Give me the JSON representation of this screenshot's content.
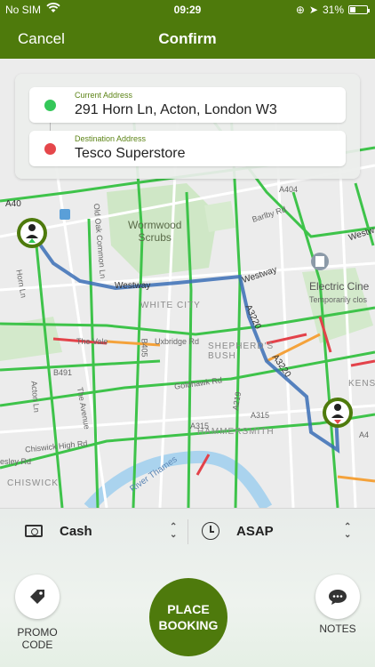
{
  "status_bar": {
    "carrier": "No SIM",
    "time": "09:29",
    "battery": "31%",
    "battery_level": 0.31
  },
  "nav": {
    "cancel_label": "Cancel",
    "title": "Confirm"
  },
  "addresses": {
    "current": {
      "label": "Current Address",
      "value": "291 Horn Ln, Acton, London W3",
      "dot_color": "#34c759"
    },
    "destination": {
      "label": "Destination Address",
      "value": "Tesco Superstore",
      "dot_color": "#e5474b"
    }
  },
  "map_labels": {
    "wormwood": "Wormwood\nScrubs",
    "white_city": "WHITE CITY",
    "shepherds_bush": "SHEPHERD'S\nBUSH",
    "hammersmith": "HAMMERSMITH",
    "chiswick": "CHISWICK",
    "kensington": "KENSIN",
    "electric": "Electric Cine",
    "electric_sub": "Temporarily clos",
    "westway1": "Westway",
    "westway2": "Westway",
    "a40": "A40",
    "a404": "A404",
    "a3220": "A3220",
    "a3220b": "A3220",
    "the_vale": "The Vale",
    "uxbridge": "Uxbridge Rd",
    "goldhawk": "Goldhawk Rd",
    "a315": "A315",
    "a315b": "A315",
    "a4": "A4",
    "b491": "B491",
    "b405": "B405",
    "a219": "A219",
    "chiswick_high": "Chiswick High Rd",
    "river": "River Thames",
    "barlby": "Barlby Rd",
    "old_oak": "Old Oak Common Ln",
    "the_avenue": "The Avenue",
    "acton_ln": "Acton Ln",
    "horn_ln": "Horn Ln",
    "westw": "Westw",
    "esley": "esley Rd"
  },
  "options": {
    "payment": "Cash",
    "time": "ASAP"
  },
  "actions": {
    "promo_label": "PROMO\nCODE",
    "place_line1": "PLACE",
    "place_line2": "BOOKING",
    "notes_label": "NOTES"
  },
  "colors": {
    "brand": "#4e7a0c",
    "route": "#3b6fb6",
    "traffic_green": "#3ec34a",
    "traffic_red": "#e3424a",
    "traffic_orange": "#f4a23b"
  }
}
